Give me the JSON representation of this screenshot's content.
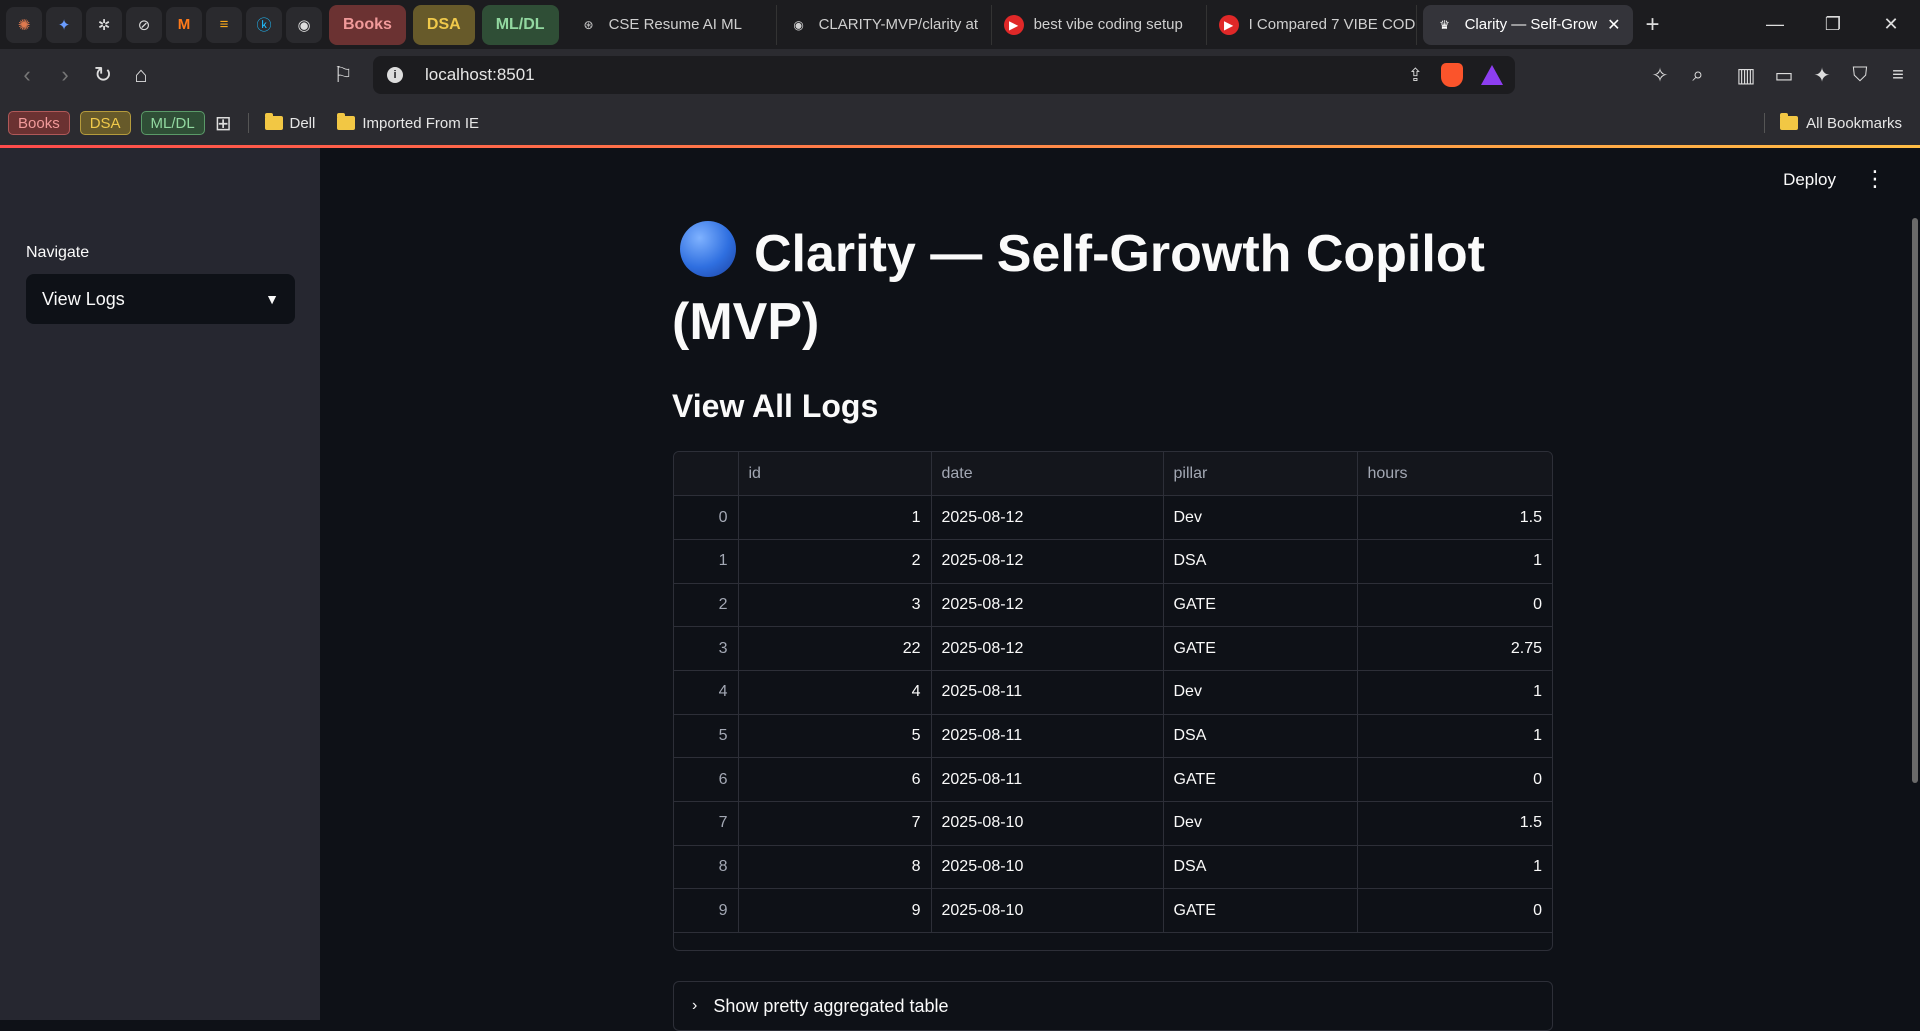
{
  "browser": {
    "pinned_icons": [
      "claude-icon",
      "gemini-icon",
      "perplexity-icon",
      "chatgpt-icon",
      "mistral-icon",
      "bolt-icon",
      "kaggle-icon",
      "github-icon"
    ],
    "tab_groups": [
      "Books",
      "DSA",
      "ML/DL"
    ],
    "tabs": [
      {
        "title": "CSE Resume AI ML",
        "icon": "openai-icon"
      },
      {
        "title": "CLARITY-MVP/clarity at",
        "icon": "github-icon"
      },
      {
        "title": "best vibe coding setup",
        "icon": "youtube-icon"
      },
      {
        "title": "I Compared 7 VIBE COD",
        "icon": "youtube-icon"
      },
      {
        "title": "Clarity — Self-Grow",
        "icon": "streamlit-icon",
        "active": true
      }
    ],
    "url": "localhost:8501",
    "bookmarks": {
      "chips": [
        "Books",
        "DSA",
        "ML/DL"
      ],
      "folders": [
        "Dell",
        "Imported From IE"
      ],
      "all_label": "All Bookmarks"
    },
    "accent_colors": {
      "tab_books": "#6b3232",
      "tab_dsa": "#675a2a",
      "tab_mldl": "#2f4e36"
    }
  },
  "app": {
    "deploy_label": "Deploy",
    "sidebar": {
      "nav_label": "Navigate",
      "selected_page": "View Logs"
    },
    "title": "Clarity — Self-Growth Copilot (MVP)",
    "subheader": "View All Logs",
    "table": {
      "columns": [
        "",
        "id",
        "date",
        "pillar",
        "hours"
      ],
      "rows": [
        {
          "idx": "0",
          "id": "1",
          "date": "2025-08-12",
          "pillar": "Dev",
          "hours": "1.5"
        },
        {
          "idx": "1",
          "id": "2",
          "date": "2025-08-12",
          "pillar": "DSA",
          "hours": "1"
        },
        {
          "idx": "2",
          "id": "3",
          "date": "2025-08-12",
          "pillar": "GATE",
          "hours": "0"
        },
        {
          "idx": "3",
          "id": "22",
          "date": "2025-08-12",
          "pillar": "GATE",
          "hours": "2.75"
        },
        {
          "idx": "4",
          "id": "4",
          "date": "2025-08-11",
          "pillar": "Dev",
          "hours": "1"
        },
        {
          "idx": "5",
          "id": "5",
          "date": "2025-08-11",
          "pillar": "DSA",
          "hours": "1"
        },
        {
          "idx": "6",
          "id": "6",
          "date": "2025-08-11",
          "pillar": "GATE",
          "hours": "0"
        },
        {
          "idx": "7",
          "id": "7",
          "date": "2025-08-10",
          "pillar": "Dev",
          "hours": "1.5"
        },
        {
          "idx": "8",
          "id": "8",
          "date": "2025-08-10",
          "pillar": "DSA",
          "hours": "1"
        },
        {
          "idx": "9",
          "id": "9",
          "date": "2025-08-10",
          "pillar": "GATE",
          "hours": "0"
        }
      ]
    },
    "expander_label": "Show pretty aggregated table"
  }
}
